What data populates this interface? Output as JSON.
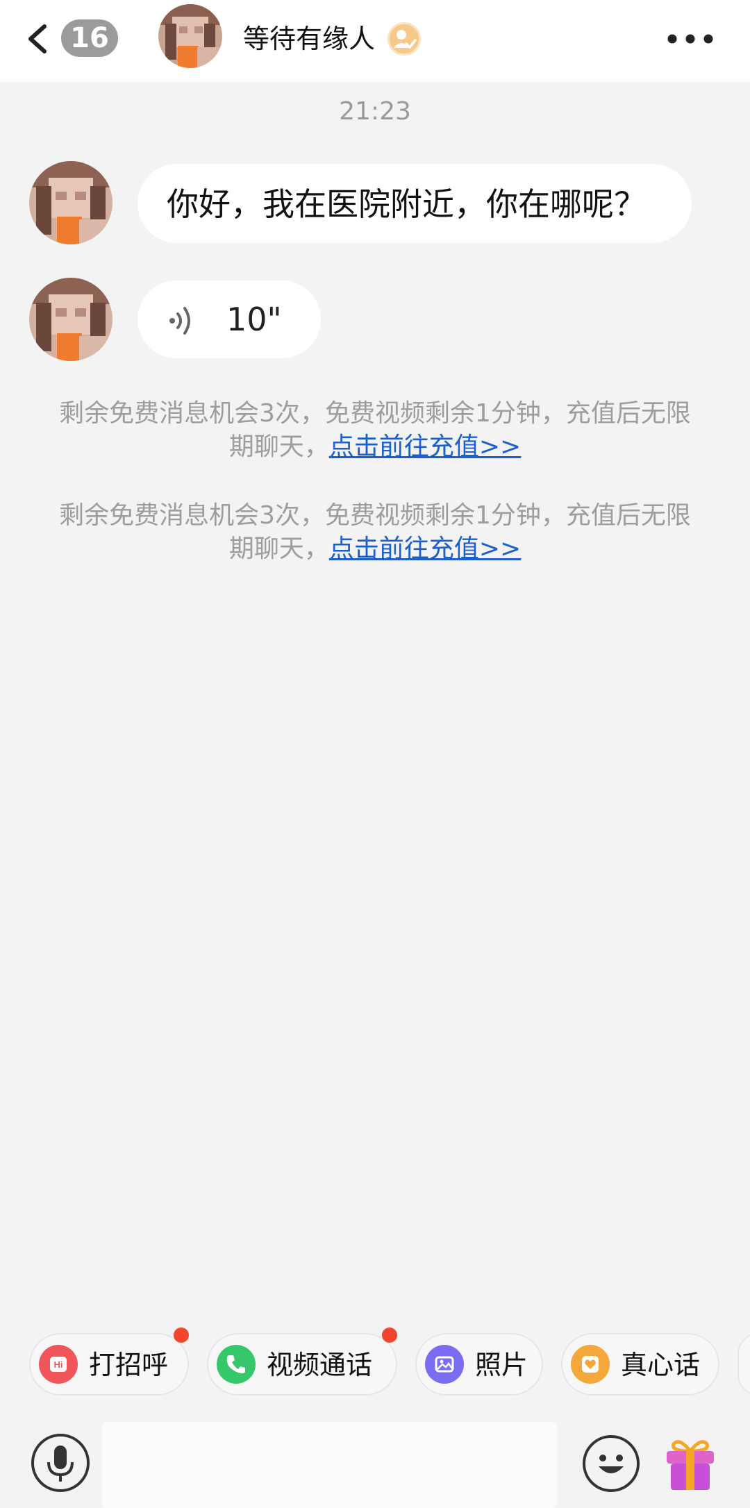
{
  "header": {
    "unread_count": "16",
    "contact_name": "等待有缘人"
  },
  "chat": {
    "timestamp": "21:23",
    "text_message": "你好，我在医院附近，你在哪呢？",
    "voice_duration": "10\"",
    "system_messages": [
      {
        "text": "剩余免费消息机会3次，免费视频剩余1分钟，充值后无限期聊天，",
        "link": "点击前往充值>>"
      },
      {
        "text": "剩余免费消息机会3次，免费视频剩余1分钟，充值后无限期聊天，",
        "link": "点击前往充值>>"
      }
    ]
  },
  "quick_actions": [
    {
      "label": "打招呼",
      "icon": "hi-icon",
      "color": "#f0555b"
    },
    {
      "label": "视频通话",
      "icon": "phone-icon",
      "color": "#35c76a"
    },
    {
      "label": "照片",
      "icon": "photo-icon",
      "color": "#7b6df2"
    },
    {
      "label": "真心话",
      "icon": "heart-icon",
      "color": "#f4a83a"
    }
  ],
  "input": {
    "placeholder": ""
  },
  "colors": {
    "link": "#1a5fcc",
    "notification_dot": "#f2452d"
  }
}
